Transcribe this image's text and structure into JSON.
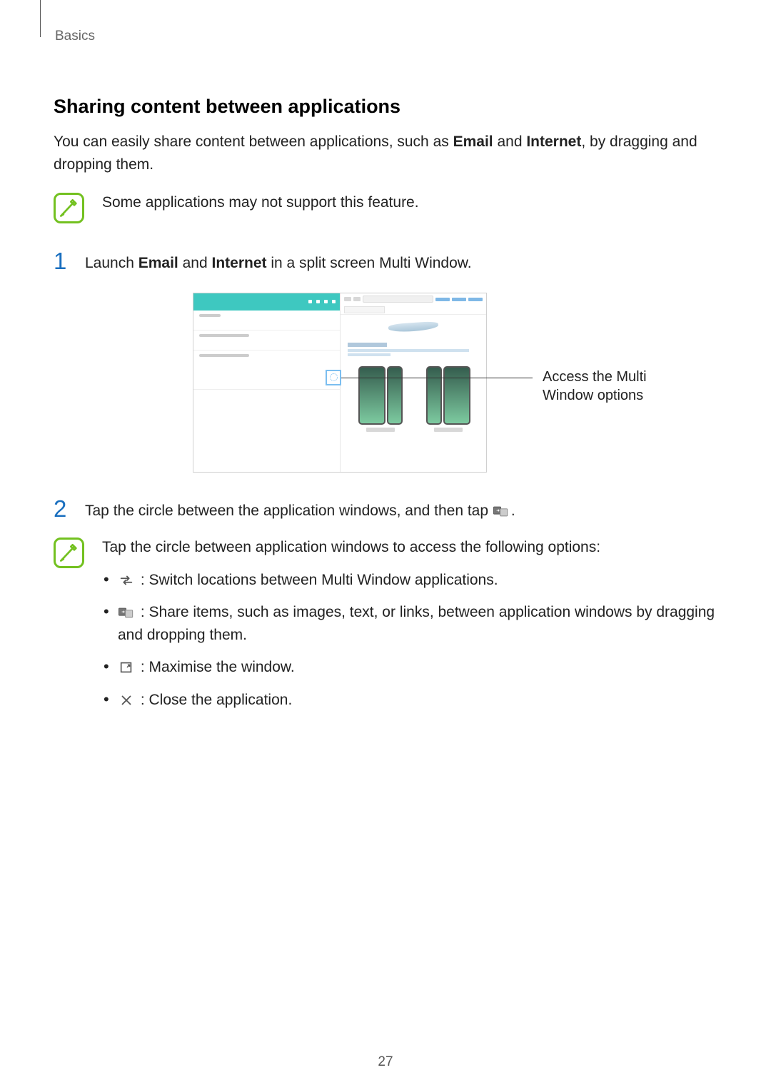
{
  "breadcrumb": "Basics",
  "section_title": "Sharing content between applications",
  "intro": {
    "p1a": "You can easily share content between applications, such as ",
    "p1b": "Email",
    "p1c": " and ",
    "p1d": "Internet",
    "p1e": ", by dragging and dropping them."
  },
  "note1": "Some applications may not support this feature.",
  "steps": {
    "s1": {
      "num": "1",
      "a": "Launch ",
      "b": "Email",
      "c": " and ",
      "d": "Internet",
      "e": " in a split screen Multi Window."
    },
    "s2": {
      "num": "2",
      "a": "Tap the circle between the application windows, and then tap ",
      "b": "."
    }
  },
  "callout": {
    "line1": "Access the Multi",
    "line2": "Window options"
  },
  "note2": {
    "lead": "Tap the circle between application windows to access the following options:",
    "b1": " : Switch locations between Multi Window applications.",
    "b2": " : Share items, such as images, text, or links, between application windows by dragging and dropping them.",
    "b3": " : Maximise the window.",
    "b4": " : Close the application."
  },
  "page_number": "27"
}
